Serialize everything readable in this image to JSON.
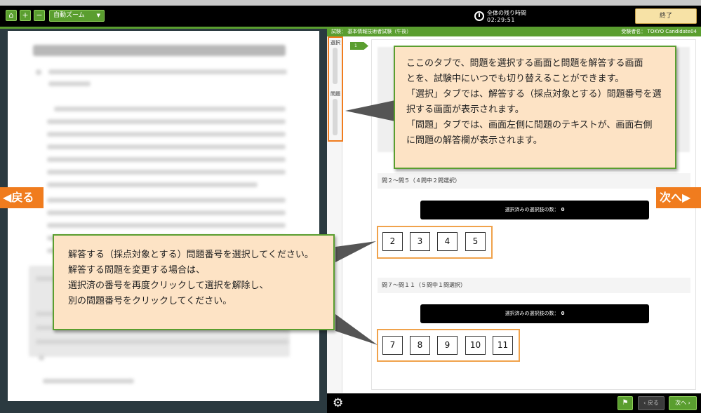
{
  "toolbar": {
    "zoom_label": "自動ズーム",
    "timer_label": "全体の残り時間",
    "timer_value": "02:29:51",
    "end_label": "終了"
  },
  "exam": {
    "title_label": "試験：",
    "title": "基本情報技術者試験（午後）",
    "candidate_label": "受験者名：",
    "candidate": "TOKYO Candidate04"
  },
  "side_tabs": [
    {
      "label": "選択"
    },
    {
      "label": "問題"
    }
  ],
  "question_badge": "1",
  "groups": [
    {
      "label": "問２～問５（４問中２問選択）",
      "count_label": "選択済みの選択肢の数：",
      "count_value": "0",
      "numbers": [
        "2",
        "3",
        "4",
        "5"
      ]
    },
    {
      "label": "問７～問１１（５問中１問選択）",
      "count_label": "選択済みの選択肢の数：",
      "count_value": "0",
      "numbers": [
        "7",
        "8",
        "9",
        "10",
        "11"
      ]
    }
  ],
  "nav": {
    "back_big": "戻る",
    "next_big": "次へ",
    "prev_small": "戻る",
    "next_small": "次へ"
  },
  "callouts": {
    "top": [
      "ここのタブで、問題を選択する画面と問題を解答する画面",
      "とを、試験中にいつでも切り替えることができます。",
      "「選択」タブでは、解答する（採点対象とする）問題番号を選",
      "択する画面が表示されます。",
      "「問題」タブでは、画面左側に問題のテキストが、画面右側",
      "に問題の解答欄が表示されます。"
    ],
    "bottom": [
      "解答する（採点対象とする）問題番号を選択してください。",
      "解答する問題を変更する場合は、",
      "選択済の番号を再度クリックして選択を解除し、",
      "別の問題番号をクリックしてください。"
    ]
  },
  "colors": {
    "accent_green": "#5a9e2f",
    "highlight_orange": "#f07c1e",
    "callout_fill": "#fde3c5"
  },
  "icons": {
    "home": "home-icon",
    "zoom_in": "plus-icon",
    "zoom_out": "minus-icon",
    "timer": "clock-icon",
    "settings": "gear-icon",
    "flag": "flag-icon"
  }
}
